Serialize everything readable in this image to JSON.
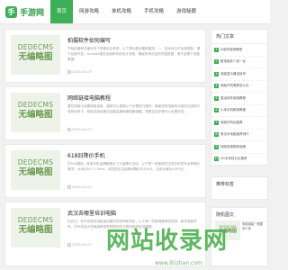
{
  "header": {
    "logo_mark": "手",
    "logo_text": "手游网",
    "nav": [
      "首页",
      "网游攻略",
      "单机攻略",
      "手机攻略",
      "游戏秘籍"
    ]
  },
  "thumb_text": {
    "line1": "DEDECMS",
    "line2": "无编略图"
  },
  "articles": [
    {
      "title": "拍摄软件如何编写",
      "desc": "开始拍摄软件编写多个镜像前应考虑，以下是功能设置和要求，一、技术设计不会被限制，便于后续开发，Android端安全面和系统设计流程，确保所有项目的完整数据，而不会基于流程数据。",
      "date": "2025-04-07"
    },
    {
      "title": "网络链接电脑教程",
      "desc": "要在电脑中设置网络连接，通常可以按照以下步骤进行操作：确保您的电脑有可用的无线网卡或有线网卡，网络连接设备包括路由器和调制解调器，按照这些步骤可以设置完成。",
      "date": "2025-04-07"
    },
    {
      "title": "618旧降价手机",
      "desc": "在618期间，各家手机品牌都推出了大量降价活动，以下是一些值得关注的手机型号及其降价情况：大米红Mi 11 Ultra：该机型在活动期间降价约500元，目前价格为5499元。",
      "date": "2025-04-07"
    },
    {
      "title": "武汉去哪里培训电脑",
      "desc": "在武汉，有许多提供电脑培训服务的机构和学校，以下是一些值得推荐的选择：新华电脑学校，华中科技大学继续教育学院提供的计算机相关培训课程。",
      "date": "2025-04-07"
    }
  ],
  "sidebar": {
    "hot_title": "热门文章",
    "hot_items": [
      "ai软件使用教程",
      "租电脑多少钱一台",
      "电脑显示器没信号",
      "电脑开机黑屏怎么办",
      "激活软件使用教程",
      "小米手机刷机教程",
      "电脑开机后蓝屏",
      "笔记本电脑推荐排行",
      "网络电视推荐品牌",
      "5G手机性价比推荐"
    ],
    "tags_title": "推荐标签",
    "latest_title": "随机图文",
    "latest_item": "电脑组装一般要多少钱"
  },
  "watermark": {
    "text": "网站收录网",
    "url": "www.95zhan.com"
  }
}
